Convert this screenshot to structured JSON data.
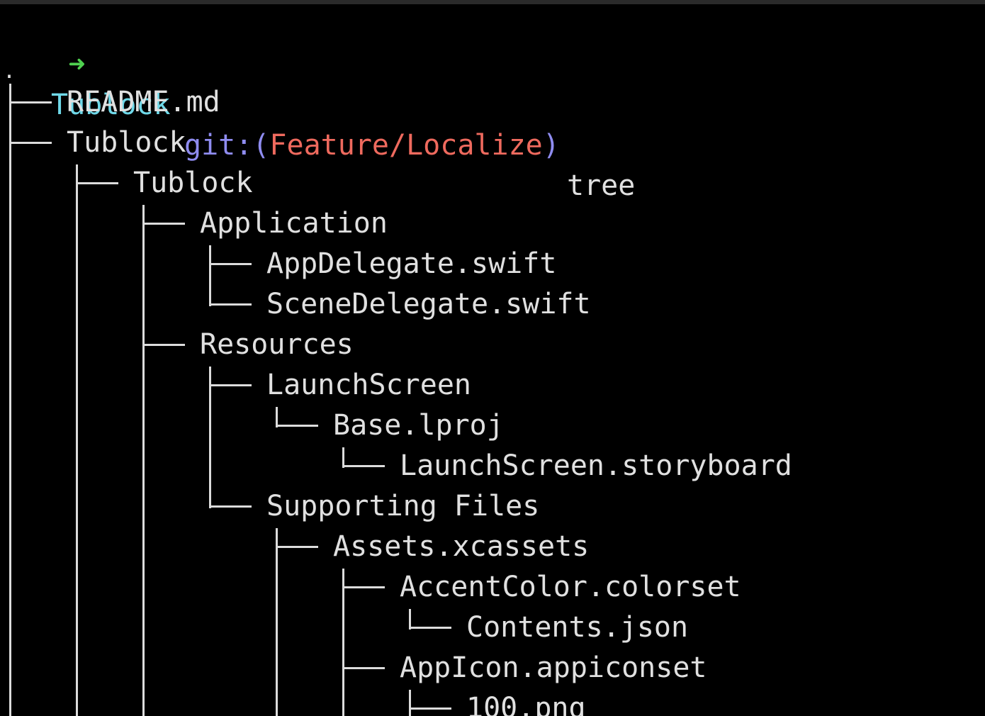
{
  "colors": {
    "background": "#000000",
    "prompt_arrow": "#4fd14f",
    "prompt_dir": "#6fd8e8",
    "prompt_git": "#8f8cf0",
    "prompt_branch": "#ef6a5e",
    "text": "#e0e0e0"
  },
  "prompt": {
    "arrow": "➜",
    "directory": "Tublock",
    "git_prefix": "git:(",
    "branch": "Feature/Localize",
    "git_suffix": ")",
    "command": "tree"
  },
  "tree": {
    "root": ".",
    "entries": [
      {
        "name": "README.md",
        "depth": 0
      },
      {
        "name": "Tublock",
        "depth": 0
      },
      {
        "name": "Tublock",
        "depth": 1
      },
      {
        "name": "Application",
        "depth": 2
      },
      {
        "name": "AppDelegate.swift",
        "depth": 3
      },
      {
        "name": "SceneDelegate.swift",
        "depth": 3
      },
      {
        "name": "Resources",
        "depth": 2
      },
      {
        "name": "LaunchScreen",
        "depth": 3
      },
      {
        "name": "Base.lproj",
        "depth": 4
      },
      {
        "name": "LaunchScreen.storyboard",
        "depth": 5
      },
      {
        "name": "Supporting Files",
        "depth": 3
      },
      {
        "name": "Assets.xcassets",
        "depth": 4
      },
      {
        "name": "AccentColor.colorset",
        "depth": 5
      },
      {
        "name": "Contents.json",
        "depth": 6
      },
      {
        "name": "AppIcon.appiconset",
        "depth": 5
      },
      {
        "name": "100.png",
        "depth": 6
      }
    ]
  }
}
